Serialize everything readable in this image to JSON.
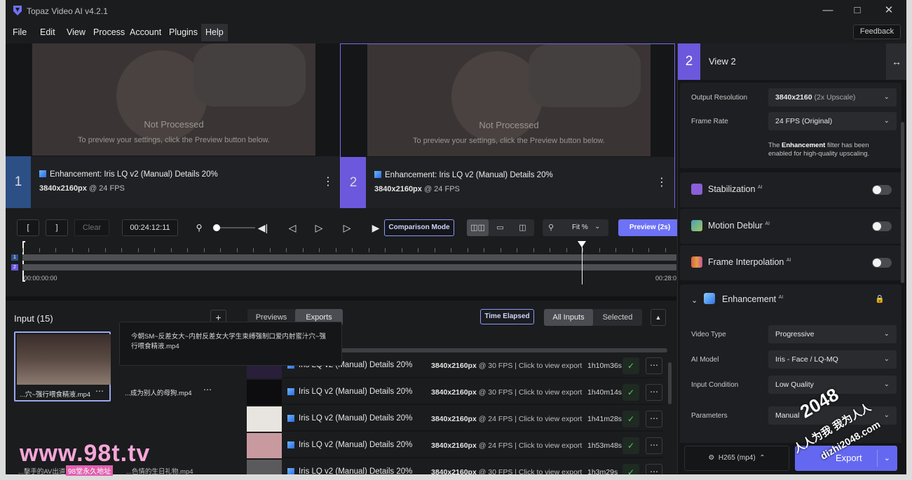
{
  "app": {
    "title": "Topaz Video AI  v4.2.1"
  },
  "menu": [
    "File",
    "Edit",
    "View",
    "Process",
    "Account",
    "Plugins",
    "Help"
  ],
  "feedback_label": "Feedback",
  "preview": {
    "not_processed": "Not Processed",
    "hint": "To preview your settings, click the Preview button below.",
    "panels": [
      {
        "num": "1",
        "model": "Enhancement: Iris LQ v2 (Manual) Details 20%",
        "res": "3840x2160px",
        "fps": " @ 24 FPS"
      },
      {
        "num": "2",
        "model": "Enhancement: Iris LQ v2 (Manual) Details 20%",
        "res": "3840x2160px",
        "fps": " @ 24 FPS"
      }
    ]
  },
  "controls": {
    "mark_in": "[",
    "mark_out": "]",
    "clear": "Clear",
    "timecode": "00:24:12:11",
    "comparison_mode": "Comparison Mode",
    "zoom": "Fit %",
    "preview_label": "Preview (2s)",
    "tl_start": "00:00:00:00",
    "tl_end": "00:28:0"
  },
  "input_panel": {
    "title": "Input (15)",
    "add": "+",
    "tooltip": "今朝SM~反差女大~内射反差女大学生束缚强制口爱内射蜜汁穴~强行喂食精液.mp4",
    "items": [
      {
        "caption": "...穴~强行喂食精液.mp4"
      },
      {
        "caption": "...成为别人的母狗.mp4"
      }
    ],
    "bottom_captions": [
      "...擊手的AV出道作",
      "...色情的生日礼物.mp4"
    ]
  },
  "exports_panel": {
    "tabs": [
      "Previews",
      "Exports"
    ],
    "time_elapsed": "Time Elapsed",
    "all_inputs": "All Inputs",
    "selected": "Selected",
    "rows": [
      {
        "name": "Iris LQ v2 (Manual) Details 20%",
        "res": "3840x2160px",
        "rest": " @ 30 FPS  |  Click to view export",
        "time": "1h10m36s"
      },
      {
        "name": "Iris LQ v2 (Manual) Details 20%",
        "res": "3840x2160px",
        "rest": " @ 30 FPS  |  Click to view export",
        "time": "1h40m14s"
      },
      {
        "name": "Iris LQ v2 (Manual) Details 20%",
        "res": "3840x2160px",
        "rest": " @ 24 FPS  |  Click to view export",
        "time": "1h41m28s"
      },
      {
        "name": "Iris LQ v2 (Manual) Details 20%",
        "res": "3840x2160px",
        "rest": " @ 24 FPS  |  Click to view export",
        "time": "1h53m48s"
      },
      {
        "name": "Iris LQ v2 (Manual) Details 20%",
        "res": "3840x2160px",
        "rest": " @ 30 FPS  |  Click to view export",
        "time": "1h3m29s"
      }
    ]
  },
  "right_panel": {
    "view_num": "2",
    "view_title": "View 2",
    "output_resolution_label": "Output Resolution",
    "output_resolution_main": "3840x2160",
    "output_resolution_sub": " (2x Upscale)",
    "frame_rate_label": "Frame Rate",
    "frame_rate_value": "24 FPS (Original)",
    "note_pre": "The ",
    "note_bold": "Enhancement",
    "note_post": " filter has been enabled for high-quality upscaling.",
    "features": [
      {
        "label": "Stabilization",
        "color": "#8a5fd8"
      },
      {
        "label": "Motion Deblur",
        "color": "#4aa0b8"
      },
      {
        "label": "Frame Interpolation",
        "color": "#e05a4a"
      }
    ],
    "ai_tag": "AI",
    "enhancement_title": "Enhancement",
    "video_type_label": "Video Type",
    "video_type_value": "Progressive",
    "ai_model_label": "AI Model",
    "ai_model_value": "Iris - Face / LQ-MQ",
    "input_condition_label": "Input Condition",
    "input_condition_value": "Low Quality",
    "parameters_label": "Parameters",
    "parameters_value": "Manual",
    "codec": "H265 (mp4)",
    "export_label": "Export"
  },
  "watermarks": {
    "site": "www.98t.tv",
    "site_sub": "98堂永久地址",
    "brand": "2048",
    "brand_sub": "人人为我 我为人人",
    "brand_url": "dizhi2048.com"
  }
}
